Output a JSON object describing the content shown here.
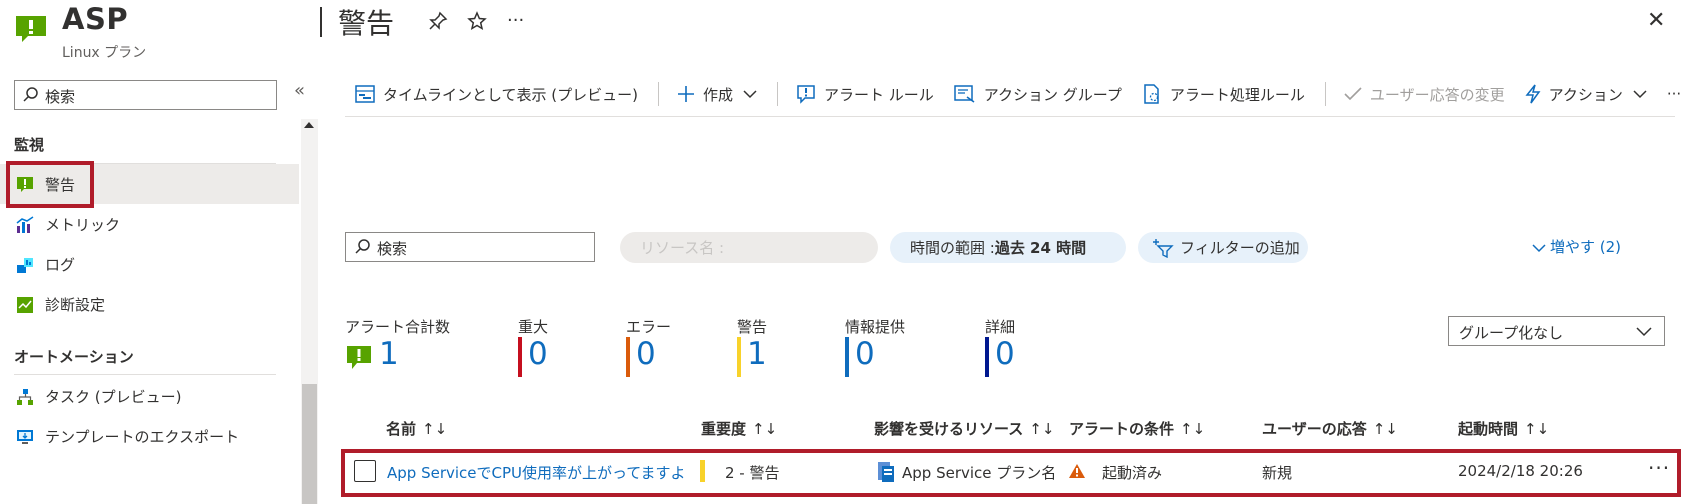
{
  "header": {
    "app_name": "ASP",
    "app_subtitle": "Linux プラン",
    "page_title": "警告",
    "ellipsis": "···",
    "close": "✕"
  },
  "sidebar": {
    "search_placeholder": "検索",
    "collapse": "«",
    "sections": [
      {
        "title": "監視",
        "items": [
          {
            "label": "警告",
            "icon": "alert-icon"
          },
          {
            "label": "メトリック",
            "icon": "metrics-icon"
          },
          {
            "label": "ログ",
            "icon": "logs-icon"
          },
          {
            "label": "診断設定",
            "icon": "diagnostic-settings-icon"
          }
        ]
      },
      {
        "title": "オートメーション",
        "items": [
          {
            "label": "タスク (プレビュー)",
            "icon": "tasks-icon"
          },
          {
            "label": "テンプレートのエクスポート",
            "icon": "export-template-icon"
          }
        ]
      }
    ]
  },
  "toolbar": {
    "timeline": "タイムラインとして表示 (プレビュー)",
    "create": "作成",
    "alert_rules": "アラート ルール",
    "action_groups": "アクション グループ",
    "processing_rules": "アラート処理ルール",
    "change_user_response": "ユーザー応答の変更",
    "actions": "アクション",
    "more": "···"
  },
  "filters": {
    "search_placeholder": "検索",
    "resource_name": "リソース名 :",
    "time_range_label": "時間の範囲 : ",
    "time_range_value": "過去 24 時間",
    "add_filter": "フィルターの追加",
    "increase": "増やす (2)"
  },
  "summary": {
    "total_label": "アラート合計数",
    "total_value": "1",
    "items": [
      {
        "label": "重大",
        "value": "0",
        "color": "#c50f1f"
      },
      {
        "label": "エラー",
        "value": "0",
        "color": "#da5b0b"
      },
      {
        "label": "警告",
        "value": "1",
        "color": "#f8d22a"
      },
      {
        "label": "情報提供",
        "value": "0",
        "color": "#0f6cbd"
      },
      {
        "label": "詳細",
        "value": "0",
        "color": "#00188f"
      }
    ],
    "group_by": "グループ化なし"
  },
  "table": {
    "columns": [
      "名前",
      "重要度",
      "影響を受けるリソース",
      "アラートの条件",
      "ユーザーの応答",
      "起動時間"
    ],
    "sort_icon": "↑↓",
    "rows": [
      {
        "name": "App ServiceでCPU使用率が上がってますよ",
        "severity": "2 - 警告",
        "resource": "App Service プラン名",
        "condition": "起動済み",
        "user_response": "新規",
        "fired_time": "2024/2/18 20:26"
      }
    ],
    "row_menu": "···"
  },
  "colors": {
    "accent": "#0f6cbd",
    "highlight_border": "#b01c2a",
    "app_green": "#57a300"
  }
}
